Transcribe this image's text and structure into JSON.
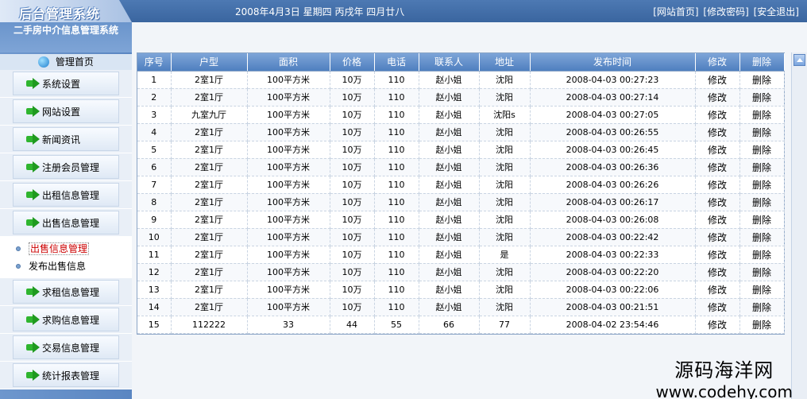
{
  "header": {
    "logo_text": "后台管理系统",
    "date_text": "2008年4月3日  星期四  丙戌年  四月廿八",
    "links": [
      "[网站首页]",
      "[修改密码]",
      "[安全退出]"
    ]
  },
  "sidebar": {
    "system_title": "二手房中介信息管理系统",
    "home_label": "管理首页",
    "menu_top": [
      "系统设置",
      "网站设置",
      "新闻资讯",
      "注册会员管理",
      "出租信息管理",
      "出售信息管理"
    ],
    "submenu": [
      {
        "label": "出售信息管理",
        "active": true
      },
      {
        "label": "发布出售信息",
        "active": false
      }
    ],
    "menu_bottom": [
      "求租信息管理",
      "求购信息管理",
      "交易信息管理",
      "统计报表管理"
    ]
  },
  "table": {
    "columns": [
      "序号",
      "户型",
      "面积",
      "价格",
      "电话",
      "联系人",
      "地址",
      "发布时间",
      "修改",
      "删除"
    ],
    "rows": [
      [
        "1",
        "2室1厅",
        "100平方米",
        "10万",
        "110",
        "赵小姐",
        "沈阳",
        "2008-04-03 00:27:23",
        "修改",
        "删除"
      ],
      [
        "2",
        "2室1厅",
        "100平方米",
        "10万",
        "110",
        "赵小姐",
        "沈阳",
        "2008-04-03 00:27:14",
        "修改",
        "删除"
      ],
      [
        "3",
        "九室九厅",
        "100平方米",
        "10万",
        "110",
        "赵小姐",
        "沈阳s",
        "2008-04-03 00:27:05",
        "修改",
        "删除"
      ],
      [
        "4",
        "2室1厅",
        "100平方米",
        "10万",
        "110",
        "赵小姐",
        "沈阳",
        "2008-04-03 00:26:55",
        "修改",
        "删除"
      ],
      [
        "5",
        "2室1厅",
        "100平方米",
        "10万",
        "110",
        "赵小姐",
        "沈阳",
        "2008-04-03 00:26:45",
        "修改",
        "删除"
      ],
      [
        "6",
        "2室1厅",
        "100平方米",
        "10万",
        "110",
        "赵小姐",
        "沈阳",
        "2008-04-03 00:26:36",
        "修改",
        "删除"
      ],
      [
        "7",
        "2室1厅",
        "100平方米",
        "10万",
        "110",
        "赵小姐",
        "沈阳",
        "2008-04-03 00:26:26",
        "修改",
        "删除"
      ],
      [
        "8",
        "2室1厅",
        "100平方米",
        "10万",
        "110",
        "赵小姐",
        "沈阳",
        "2008-04-03 00:26:17",
        "修改",
        "删除"
      ],
      [
        "9",
        "2室1厅",
        "100平方米",
        "10万",
        "110",
        "赵小姐",
        "沈阳",
        "2008-04-03 00:26:08",
        "修改",
        "删除"
      ],
      [
        "10",
        "2室1厅",
        "100平方米",
        "10万",
        "110",
        "赵小姐",
        "沈阳",
        "2008-04-03 00:22:42",
        "修改",
        "删除"
      ],
      [
        "11",
        "2室1厅",
        "100平方米",
        "10万",
        "110",
        "赵小姐",
        "是",
        "2008-04-03 00:22:33",
        "修改",
        "删除"
      ],
      [
        "12",
        "2室1厅",
        "100平方米",
        "10万",
        "110",
        "赵小姐",
        "沈阳",
        "2008-04-03 00:22:20",
        "修改",
        "删除"
      ],
      [
        "13",
        "2室1厅",
        "100平方米",
        "10万",
        "110",
        "赵小姐",
        "沈阳",
        "2008-04-03 00:22:06",
        "修改",
        "删除"
      ],
      [
        "14",
        "2室1厅",
        "100平方米",
        "10万",
        "110",
        "赵小姐",
        "沈阳",
        "2008-04-03 00:21:51",
        "修改",
        "删除"
      ],
      [
        "15",
        "112222",
        "33",
        "44",
        "55",
        "66",
        "77",
        "2008-04-02 23:54:46",
        "修改",
        "删除"
      ]
    ]
  },
  "watermark": {
    "cn": "源码海洋网",
    "url": "www.codehy.com"
  },
  "colors": {
    "header_blue": "#3a659f",
    "sidebar_blue": "#5a86c2",
    "table_header": "#4f7fbf",
    "active_red": "#cc0000"
  }
}
